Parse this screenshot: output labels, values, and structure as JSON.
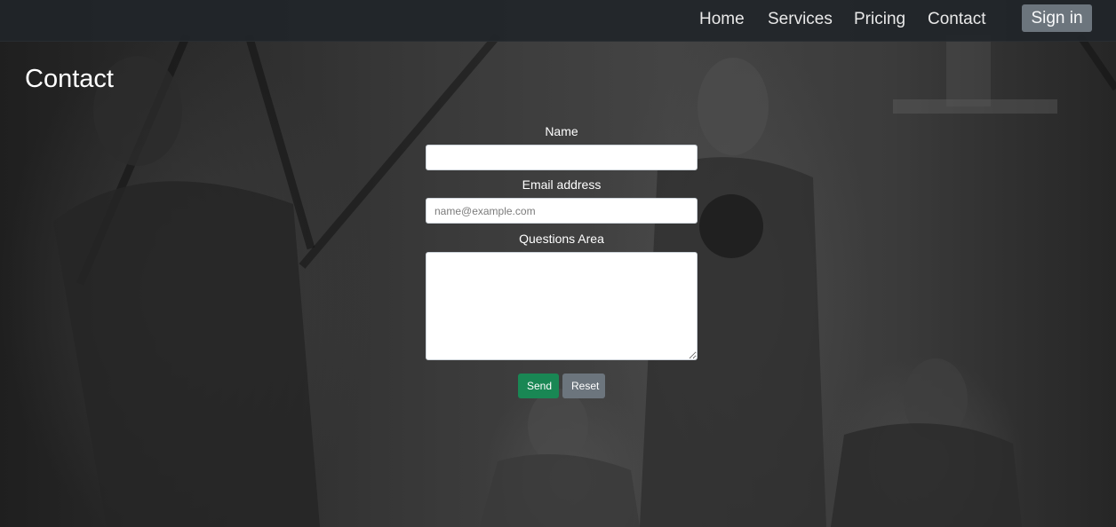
{
  "navbar": {
    "links": [
      "Home",
      "Services",
      "Pricing",
      "Contact"
    ],
    "signin_label": "Sign in"
  },
  "page": {
    "title": "Contact"
  },
  "form": {
    "name_label": "Name",
    "name_value": "",
    "email_label": "Email address",
    "email_placeholder": "name@example.com",
    "email_value": "",
    "questions_label": "Questions Area",
    "questions_value": "",
    "send_label": "Send",
    "reset_label": "Reset"
  },
  "colors": {
    "navbar_bg": "#212529",
    "send_button": "#198754",
    "reset_button": "#6c757d",
    "signin_button": "#6c757d"
  }
}
